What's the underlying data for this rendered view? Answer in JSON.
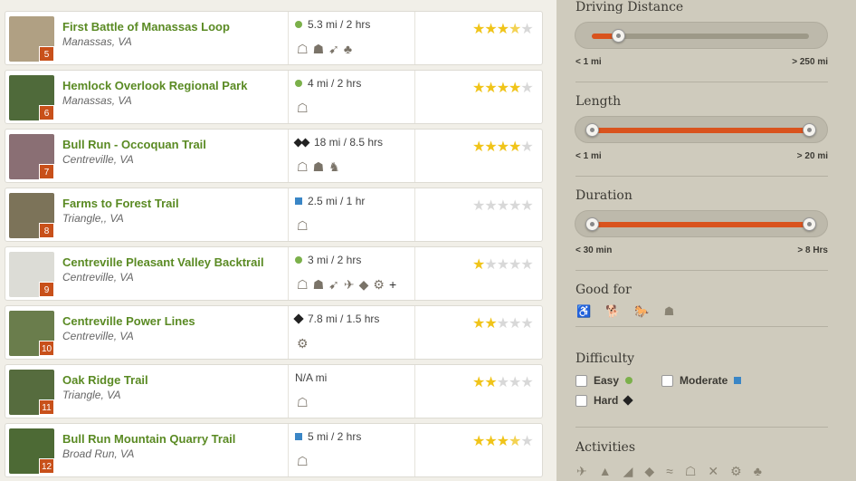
{
  "trails": [
    {
      "name": "First Battle of Manassas Loop",
      "location": "Manassas, VA",
      "num": "5",
      "distance": "5.3 mi / 2 hrs",
      "difficulty": "easy",
      "rating": 3.5,
      "activities": [
        "hiking-icon",
        "walking-icon",
        "running-icon",
        "nature-trips-icon"
      ],
      "thumb": "#b0a083"
    },
    {
      "name": "Hemlock Overlook Regional Park",
      "location": "Manassas, VA",
      "num": "6",
      "distance": "4 mi / 2 hrs",
      "difficulty": "easy",
      "rating": 4,
      "activities": [
        "hiking-icon"
      ],
      "thumb": "#4f6a3a"
    },
    {
      "name": "Bull Run - Occoquan Trail",
      "location": "Centreville, VA",
      "num": "7",
      "distance": "18 mi / 8.5 hrs",
      "difficulty": "very-hard",
      "rating": 4,
      "activities": [
        "hiking-icon",
        "walking-icon",
        "horseback-icon"
      ],
      "thumb": "#8a6f74"
    },
    {
      "name": "Farms to Forest Trail",
      "location": "Triangle,, VA",
      "num": "8",
      "distance": "2.5 mi / 1 hr",
      "difficulty": "moderate",
      "rating": 0,
      "activities": [
        "hiking-icon"
      ],
      "thumb": "#7c7359"
    },
    {
      "name": "Centreville Pleasant Valley Backtrail",
      "location": "Centreville, VA",
      "num": "9",
      "distance": "3 mi / 2 hrs",
      "difficulty": "easy",
      "rating": 1,
      "activities": [
        "hiking-icon",
        "walking-icon",
        "running-icon",
        "birding-icon",
        "fishing-icon",
        "mountain-biking-icon"
      ],
      "more": "+",
      "thumb": "#dcdcd6"
    },
    {
      "name": "Centreville Power Lines",
      "location": "Centreville, VA",
      "num": "10",
      "distance": "7.8 mi / 1.5 hrs",
      "difficulty": "hard",
      "rating": 2,
      "activities": [
        "mountain-biking-icon"
      ],
      "thumb": "#6a7d4c"
    },
    {
      "name": "Oak Ridge Trail",
      "location": "Triangle, VA",
      "num": "11",
      "distance": "N/A mi",
      "difficulty": "none",
      "rating": 2,
      "activities": [
        "hiking-icon"
      ],
      "thumb": "#566c3e"
    },
    {
      "name": "Bull Run Mountain Quarry Trail",
      "location": "Broad Run, VA",
      "num": "12",
      "distance": "5 mi / 2 hrs",
      "difficulty": "moderate",
      "rating": 3.5,
      "activities": [
        "hiking-icon"
      ],
      "thumb": "#4d6a35"
    }
  ],
  "filters": {
    "driving": {
      "title": "Driving Distance",
      "min_label": "< 1 mi",
      "max_label": "> 250 mi",
      "low": 0,
      "high": 0.12
    },
    "length": {
      "title": "Length",
      "min_label": "< 1 mi",
      "max_label": "> 20 mi",
      "low": 0,
      "high": 1
    },
    "duration": {
      "title": "Duration",
      "min_label": "< 30 min",
      "max_label": "> 8 Hrs",
      "low": 0,
      "high": 1
    },
    "good_for": {
      "title": "Good for",
      "icons": [
        "wheelchair-icon",
        "dog-icon",
        "horse-icon",
        "kids-icon"
      ]
    },
    "difficulty": {
      "title": "Difficulty",
      "easy": "Easy",
      "moderate": "Moderate",
      "hard": "Hard"
    },
    "activities": {
      "title": "Activities",
      "icons": [
        "birding-icon",
        "camping-icon",
        "canoeing-icon",
        "fishing-icon",
        "swimming-icon",
        "hiking-icon",
        "skiing-icon",
        "mountain-biking-icon",
        "nature-trips-icon"
      ]
    }
  }
}
